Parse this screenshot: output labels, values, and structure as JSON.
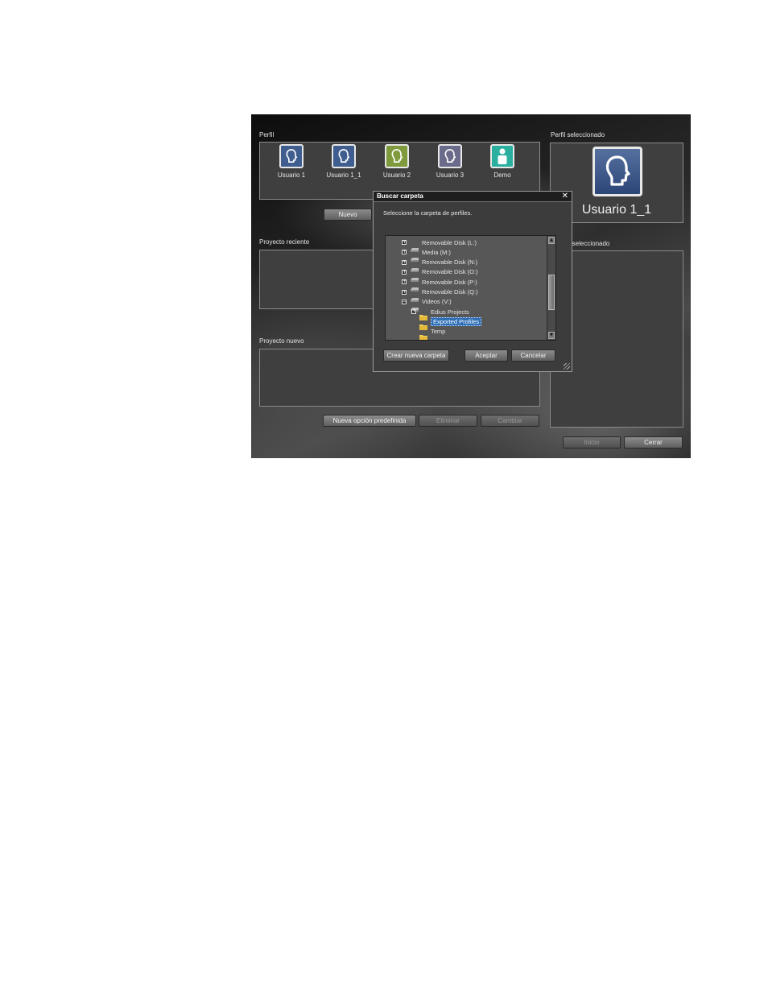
{
  "left": {
    "profile_label": "Perfil",
    "profiles": [
      {
        "name": "Usuario 1",
        "color": "#3f5d8f"
      },
      {
        "name": "Usuario 1_1",
        "color": "#3f5d8f"
      },
      {
        "name": "Usuario 2",
        "color": "#7f9a3c"
      },
      {
        "name": "Usuario 3",
        "color": "#6a6a8a"
      },
      {
        "name": "Demo",
        "color": "#2bb0a0"
      }
    ],
    "new_button": "Nuevo",
    "recent_label": "Proyecto reciente",
    "new_project_label": "Proyecto nuevo",
    "new_preset_button": "Nueva opción predefinida",
    "delete_button": "Eliminar",
    "change_button": "Cambiar"
  },
  "right": {
    "selected_profile_label": "Perfil seleccionado",
    "selected_profile_name": "Usuario 1_1",
    "selected_preset_label": "e seleccionado",
    "start_button": "Inicio",
    "close_button": "Cerrar"
  },
  "dialog": {
    "title": "Buscar carpeta",
    "message": "Seleccione la carpeta de perfiles.",
    "tree": [
      {
        "label": "Removable Disk (L:)",
        "type": "drive",
        "expander": "+"
      },
      {
        "label": "Media (M:)",
        "type": "drive",
        "expander": "+"
      },
      {
        "label": "Removable Disk (N:)",
        "type": "drive",
        "expander": "+"
      },
      {
        "label": "Removable Disk (O:)",
        "type": "drive",
        "expander": "+"
      },
      {
        "label": "Removable Disk (P:)",
        "type": "drive",
        "expander": "+"
      },
      {
        "label": "Removable Disk (Q:)",
        "type": "drive",
        "expander": "+"
      },
      {
        "label": "Videos (V:)",
        "type": "drive",
        "expander": "−"
      },
      {
        "label": "Edius Projects",
        "type": "folder",
        "expander": "+"
      },
      {
        "label": "Exported Profiles",
        "type": "folder",
        "expander": "",
        "selected": true
      },
      {
        "label": "Temp",
        "type": "folder",
        "expander": ""
      }
    ],
    "new_folder_button": "Crear nueva carpeta",
    "ok_button": "Aceptar",
    "cancel_button": "Cancelar"
  }
}
